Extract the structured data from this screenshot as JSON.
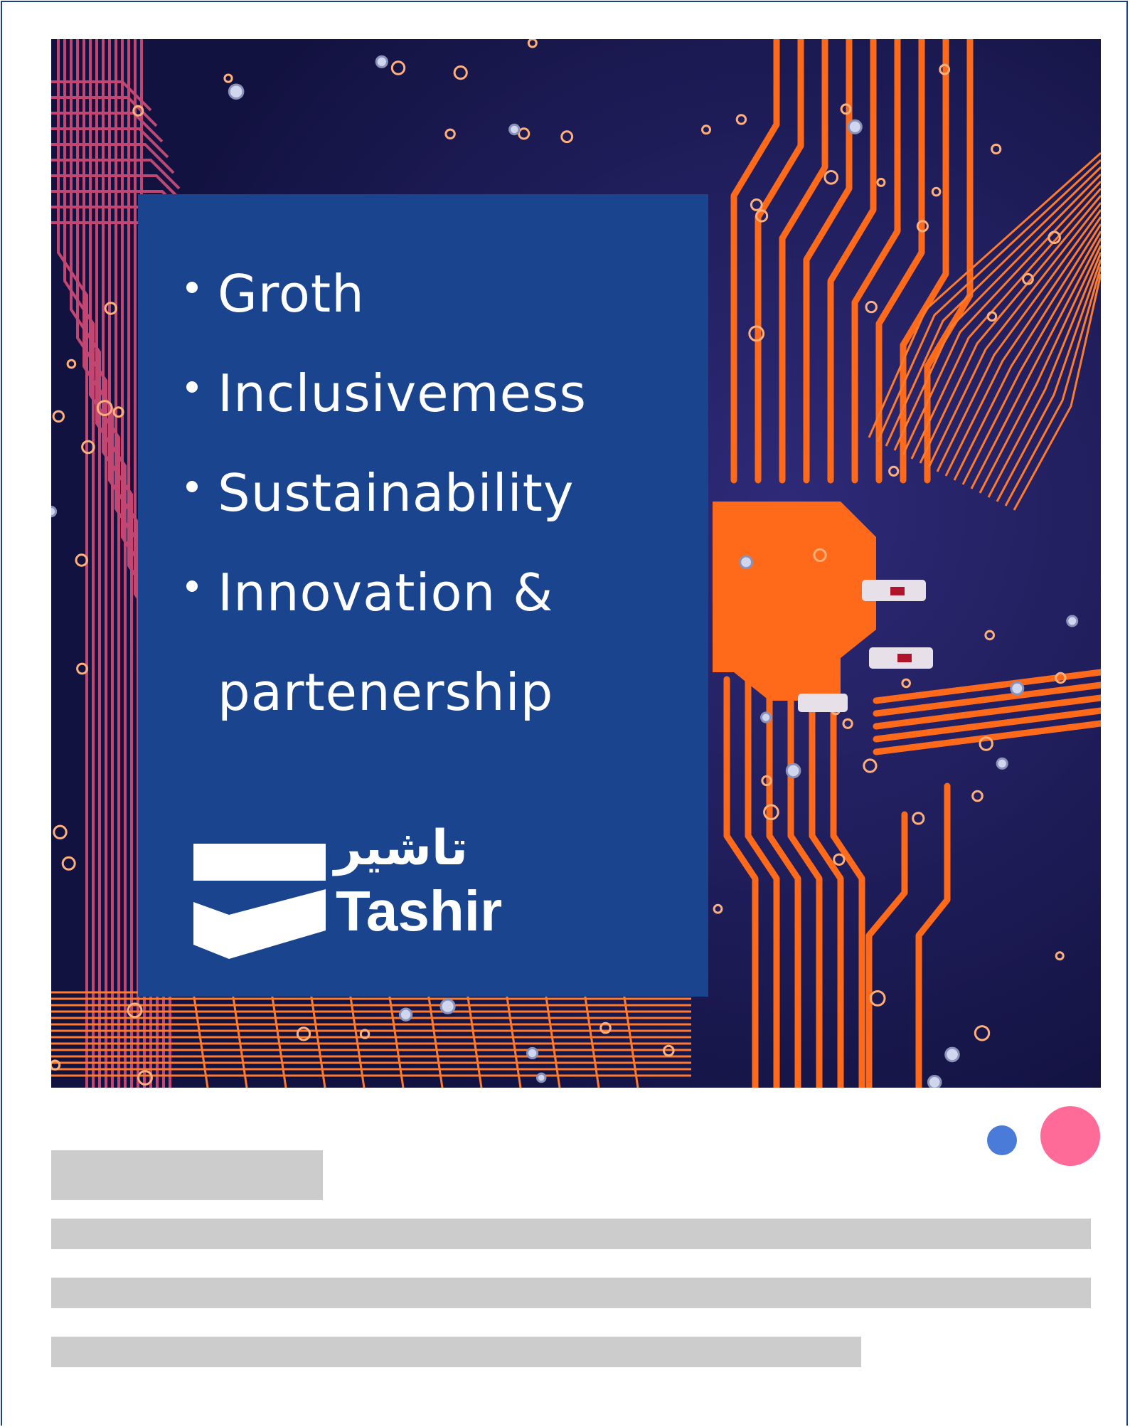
{
  "post": {
    "values": [
      {
        "text": "Groth"
      },
      {
        "text": "Inclusivemess"
      },
      {
        "text": "Sustainability"
      },
      {
        "text": "Innovation &"
      },
      {
        "text": "partenership"
      }
    ],
    "logo": {
      "arabic": "تاشير",
      "latin": "Tashir"
    }
  },
  "image": {
    "subject": "circuit-board",
    "colors": {
      "board": "#1a1a52",
      "trace": "#ff6a1a",
      "trace_pink": "#e0507a",
      "pad": "#ffb07a",
      "panel": "#1a448d"
    }
  },
  "carousel": {
    "indicators": [
      {
        "color": "#4a7bd8",
        "active": false
      },
      {
        "color": "#ff6b98",
        "active": true
      }
    ]
  },
  "placeholder_color": "#cccccc",
  "frame_color": "#1d3f86"
}
